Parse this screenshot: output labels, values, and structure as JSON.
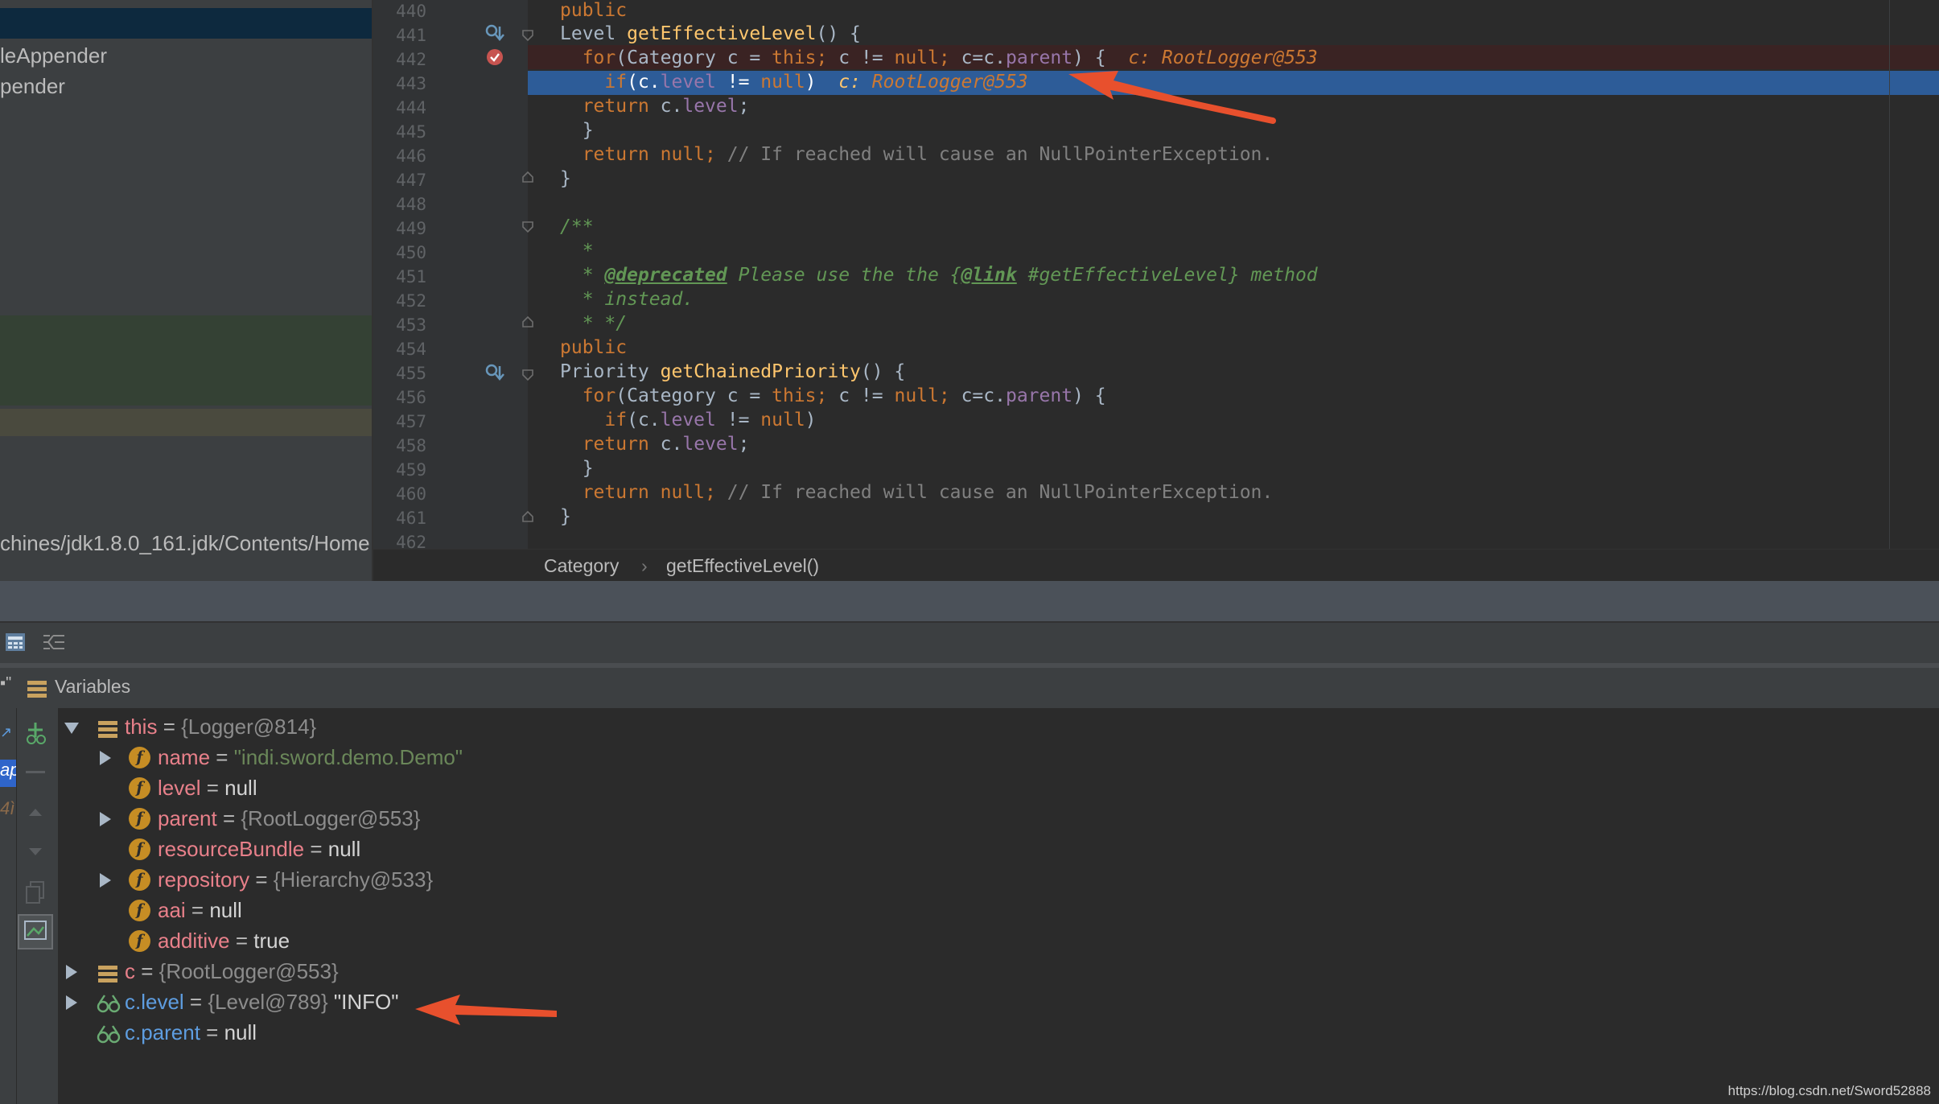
{
  "left_panel": {
    "tree_items": [
      "leAppender",
      "pender"
    ],
    "path_text": "chines/jdk1.8.0_161.jdk/Contents/Home"
  },
  "editor": {
    "line_numbers": [
      "440",
      "441",
      "442",
      "443",
      "444",
      "445",
      "446",
      "447",
      "448",
      "449",
      "450",
      "451",
      "452",
      "453",
      "454",
      "455",
      "456",
      "457",
      "458",
      "459",
      "460",
      "461",
      "462"
    ],
    "inline_value_label": "c:",
    "inline_value": "RootLogger@553"
  },
  "breadcrumb": {
    "class_name": "Category",
    "separator": "›",
    "method_name": "getEffectiveLevel()"
  },
  "variables_panel": {
    "title": "Variables",
    "rows": [
      {
        "name": "this",
        "eq": " = ",
        "value": "{Logger@814}",
        "extra": ""
      },
      {
        "name": "name",
        "eq": " = ",
        "value": "\"indi.sword.demo.Demo\"",
        "extra": ""
      },
      {
        "name": "level",
        "eq": " = ",
        "value": "null",
        "extra": ""
      },
      {
        "name": "parent",
        "eq": " = ",
        "value": "{RootLogger@553}",
        "extra": ""
      },
      {
        "name": "resourceBundle",
        "eq": " = ",
        "value": "null",
        "extra": ""
      },
      {
        "name": "repository",
        "eq": " = ",
        "value": "{Hierarchy@533}",
        "extra": ""
      },
      {
        "name": "aai",
        "eq": " = ",
        "value": "null",
        "extra": ""
      },
      {
        "name": "additive",
        "eq": " = ",
        "value": "true",
        "extra": ""
      },
      {
        "name": "c",
        "eq": " = ",
        "value": "{RootLogger@553}",
        "extra": ""
      },
      {
        "name": "c.level",
        "eq": " = ",
        "value": "{Level@789}",
        "extra": " \"INFO\""
      },
      {
        "name": "c.parent",
        "eq": " = ",
        "value": "null",
        "extra": ""
      }
    ]
  },
  "side_labels": [
    "ap",
    "4ì"
  ],
  "watermark": "https://blog.csdn.net/Sword52888",
  "colors": {
    "annotation_arrow": "#e8502d",
    "execution_line": "#2d5c98",
    "breakpoint": "#c75450"
  }
}
